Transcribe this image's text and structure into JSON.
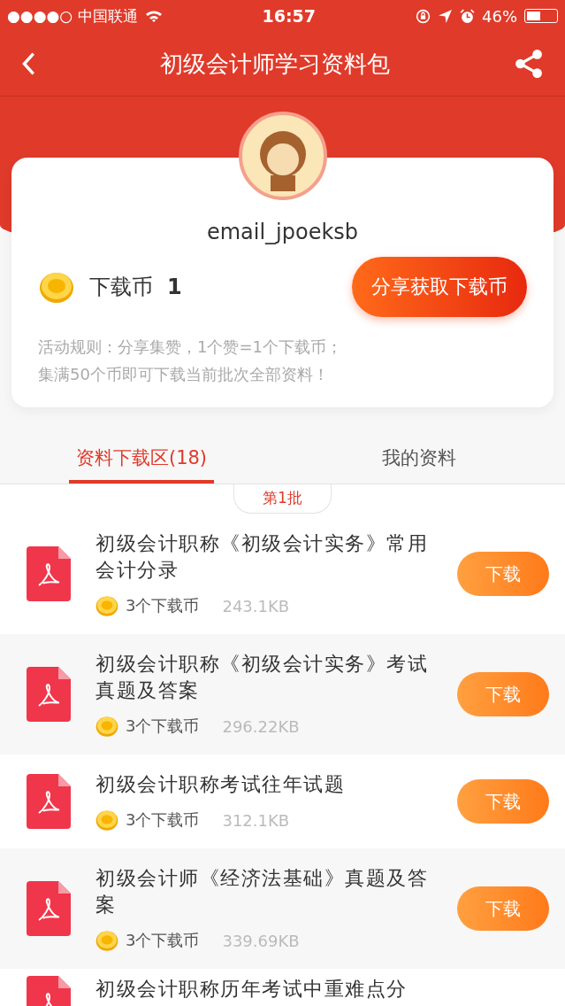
{
  "status_bar": {
    "carrier": "●●●●○ 中国联通",
    "time": "16:57",
    "battery": "46%"
  },
  "nav": {
    "title": "初级会计师学习资料包"
  },
  "profile": {
    "username": "email_jpoeksb",
    "coin_label": "下载币",
    "coin_count": "1",
    "share_button": "分享获取下载币",
    "rules": [
      "活动规则：分享集赞，1个赞=1个下载币；",
      "集满50个币即可下载当前批次全部资料！"
    ]
  },
  "tabs": [
    {
      "label": "资料下载区(18)",
      "selected": true
    },
    {
      "label": "我的资料",
      "selected": false
    }
  ],
  "batch": "第1批",
  "files": [
    {
      "title": "初级会计职称《初级会计实务》常用会计分录",
      "cost": "3个下载币",
      "size": "243.1KB",
      "button": "下载"
    },
    {
      "title": "初级会计职称《初级会计实务》考试真题及答案",
      "cost": "3个下载币",
      "size": "296.22KB",
      "button": "下载"
    },
    {
      "title": "初级会计职称考试往年试题",
      "cost": "3个下载币",
      "size": "312.1KB",
      "button": "下载"
    },
    {
      "title": "初级会计师《经济法基础》真题及答案",
      "cost": "3个下载币",
      "size": "339.69KB",
      "button": "下载"
    },
    {
      "title": "初级会计职称历年考试中重难点分"
    }
  ]
}
